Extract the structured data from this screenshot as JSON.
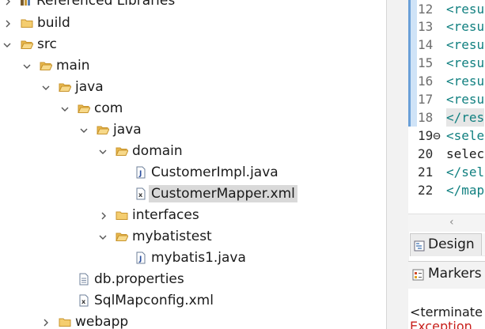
{
  "explorer": {
    "rows": [
      {
        "label": "Referenced Libraries",
        "icon": "library-icon",
        "expanded": false
      },
      {
        "label": "build",
        "icon": "folder-icon",
        "expanded": false
      },
      {
        "label": "src",
        "icon": "folder-icon",
        "expanded": true
      },
      {
        "label": "main",
        "icon": "folder-open-icon",
        "expanded": true
      },
      {
        "label": "java",
        "icon": "folder-open-icon",
        "expanded": true
      },
      {
        "label": "com",
        "icon": "folder-open-icon",
        "expanded": true
      },
      {
        "label": "java",
        "icon": "folder-open-icon",
        "expanded": true
      },
      {
        "label": "domain",
        "icon": "folder-open-icon",
        "expanded": true
      },
      {
        "label": "CustomerImpl.java",
        "icon": "java-file-icon"
      },
      {
        "label": "CustomerMapper.xml",
        "icon": "xml-file-icon",
        "selected": true
      },
      {
        "label": "interfaces",
        "icon": "folder-icon",
        "expanded": false
      },
      {
        "label": "mybatistest",
        "icon": "folder-open-icon",
        "expanded": true
      },
      {
        "label": "mybatis1.java",
        "icon": "java-file-icon"
      },
      {
        "label": "db.properties",
        "icon": "properties-file-icon"
      },
      {
        "label": "SqlMapconfig.xml",
        "icon": "xml-file-icon"
      },
      {
        "label": "webapp",
        "icon": "folder-icon",
        "expanded": false
      }
    ]
  },
  "editor": {
    "lines": [
      {
        "num": "12",
        "text": "<resu"
      },
      {
        "num": "13",
        "text": "<resu"
      },
      {
        "num": "14",
        "text": "<resu"
      },
      {
        "num": "15",
        "text": "<resu"
      },
      {
        "num": "16",
        "text": "<resu"
      },
      {
        "num": "17",
        "text": "<resu"
      },
      {
        "num": "18",
        "text": "</res"
      },
      {
        "num": "19⊖",
        "text": "<sele"
      },
      {
        "num": "20",
        "text": "selec"
      },
      {
        "num": "21",
        "text": "</sel"
      },
      {
        "num": "22",
        "text": "</map"
      }
    ]
  },
  "tabs": {
    "design": "Design"
  },
  "markers": {
    "title": "Markers",
    "console_line1": "<terminate",
    "console_line2": "Exception"
  },
  "colors": {
    "tag": "#118080",
    "selection": "#d9d9d9",
    "folder": "#e8b54a",
    "error": "#c8201c"
  }
}
